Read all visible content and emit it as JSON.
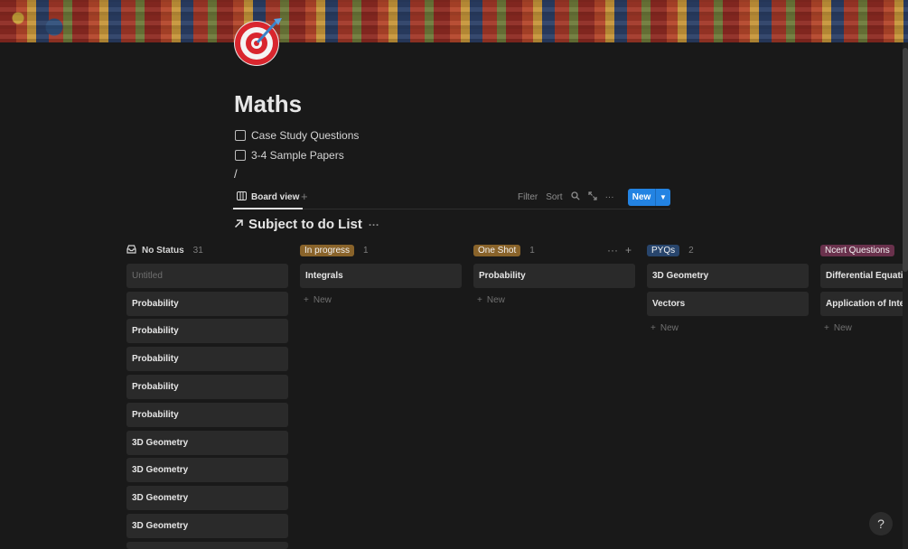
{
  "page": {
    "title": "Maths",
    "todos": [
      "Case Study Questions",
      "3-4 Sample Papers"
    ],
    "slash": "/",
    "icon": "dart-target-icon"
  },
  "viewbar": {
    "tab_label": "Board view",
    "add": "+",
    "filter": "Filter",
    "sort": "Sort",
    "more": "···",
    "new_label": "New"
  },
  "database": {
    "title": "Subject to do List",
    "more": "···"
  },
  "columns": [
    {
      "label": "No Status",
      "count": "31",
      "tag_color": null,
      "cards": [
        "Untitled",
        "Probability",
        "Probability",
        "Probability",
        "Probability",
        "Probability",
        "3D Geometry",
        "3D Geometry",
        "3D Geometry",
        "3D Geometry"
      ],
      "new_label": null
    },
    {
      "label": "In progress",
      "count": "1",
      "tag_color": "#89632a",
      "cards": [
        "Integrals"
      ],
      "new_label": "New"
    },
    {
      "label": "One Shot",
      "count": "1",
      "tag_color": "#89632a",
      "cards": [
        "Probability"
      ],
      "new_label": "New"
    },
    {
      "label": "PYQs",
      "count": "2",
      "tag_color": "#28456c",
      "cards": [
        "3D Geometry",
        "Vectors"
      ],
      "new_label": "New"
    },
    {
      "label": "Ncert Questions",
      "count": "",
      "tag_color": "#69314c",
      "cards": [
        "Differential Equatio",
        "Application of Integ"
      ],
      "new_label": "New"
    }
  ],
  "help": "?",
  "colors": {
    "accent": "#2383e2",
    "background": "#191919",
    "card": "#2a2a2a"
  }
}
